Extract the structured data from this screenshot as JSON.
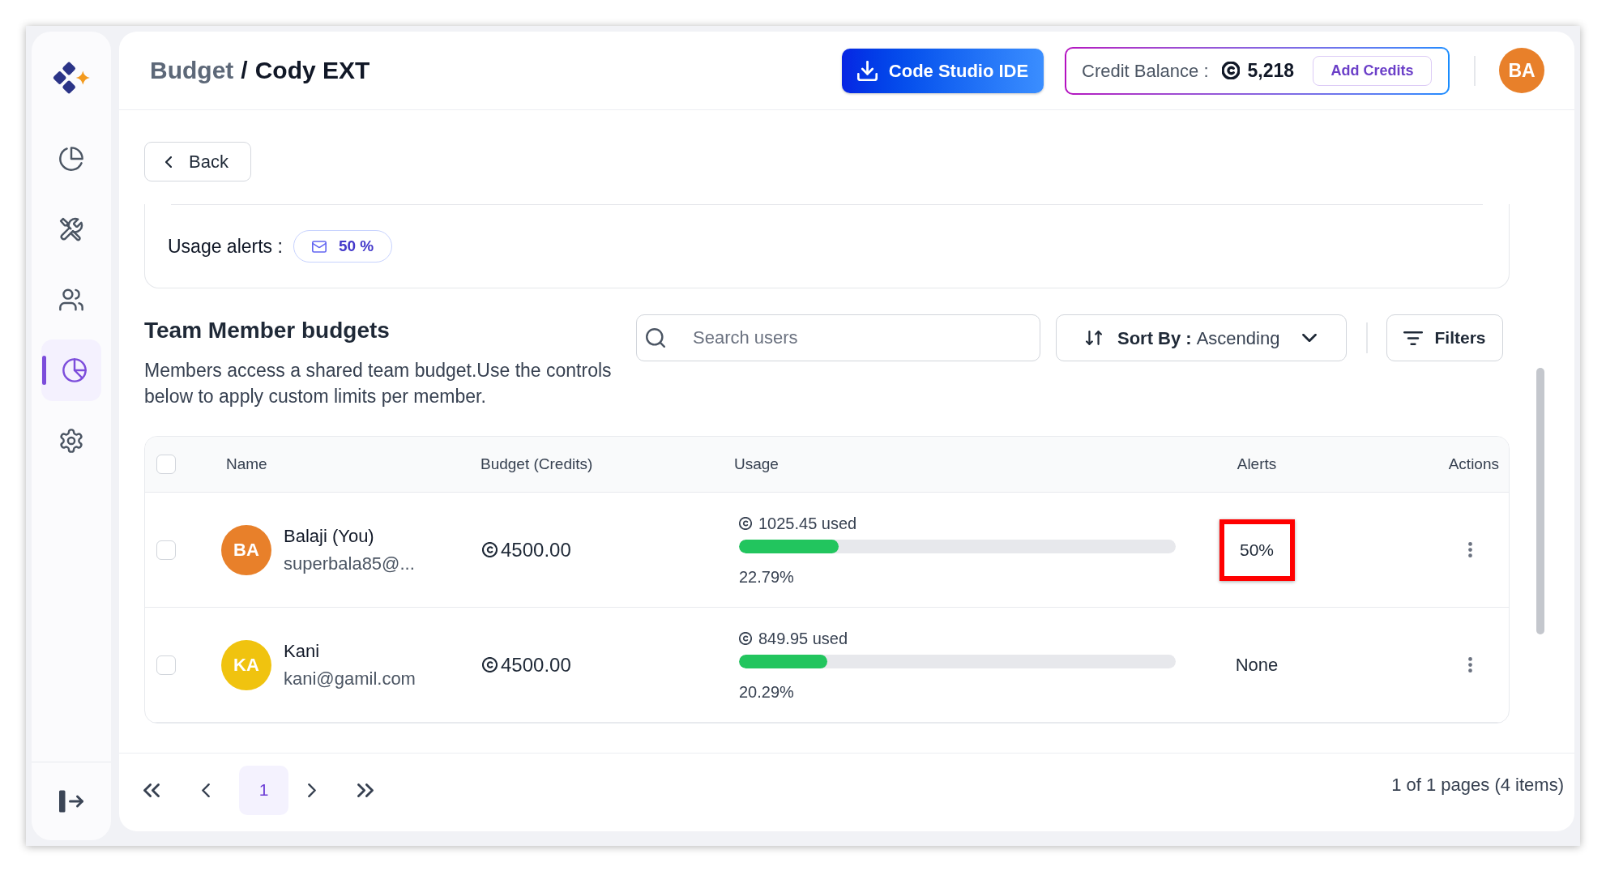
{
  "sidebar": {
    "items": [
      {
        "selected": false
      },
      {
        "selected": false
      },
      {
        "selected": false
      },
      {
        "selected": true
      },
      {
        "selected": false
      }
    ]
  },
  "header": {
    "breadcrumb": {
      "parent": "Budget",
      "separator": "/",
      "current": "Cody EXT"
    },
    "ide_button": "Code Studio IDE",
    "credit_balance": {
      "label": "Credit Balance :",
      "value": "5,218",
      "button": "Add Credits"
    },
    "avatar": {
      "initials": "BA",
      "color": "#e8802a"
    }
  },
  "back_button": "Back",
  "usage_alerts": {
    "label": "Usage alerts :",
    "value": "50 %"
  },
  "team_budgets": {
    "title": "Team Member budgets",
    "description": "Members access a shared team budget.Use the controls below to apply custom limits per member.",
    "search": {
      "placeholder": "Search users"
    },
    "sort": {
      "label": "Sort By :",
      "value": "Ascending"
    },
    "filters_button": "Filters"
  },
  "table": {
    "select_all": {
      "checked": false
    },
    "columns": [
      "Name",
      "Budget (Credits)",
      "Usage",
      "Alerts",
      "Actions"
    ],
    "rows": [
      {
        "checked": false,
        "avatar": {
          "initials": "BA",
          "color": "#e8802a"
        },
        "name": "Balaji (You)",
        "email": "superbala85@...",
        "budget": "4500.00",
        "used": "1025.45 used",
        "level": 0.2279,
        "percent": "22.79%",
        "alert": {
          "text": "50%",
          "highlighted": true
        }
      },
      {
        "checked": false,
        "avatar": {
          "initials": "KA",
          "color": "#f0c30f"
        },
        "name": "Kani",
        "email": "kani@gamil.com",
        "budget": "4500.00",
        "used": "849.95 used",
        "level": 0.2029,
        "percent": "20.29%",
        "alert": {
          "text": "None",
          "highlighted": false
        }
      }
    ]
  },
  "pagination": {
    "pages": [
      {
        "label": "1",
        "selected": true
      }
    ],
    "summary": "1 of 1 pages (4 items)"
  }
}
